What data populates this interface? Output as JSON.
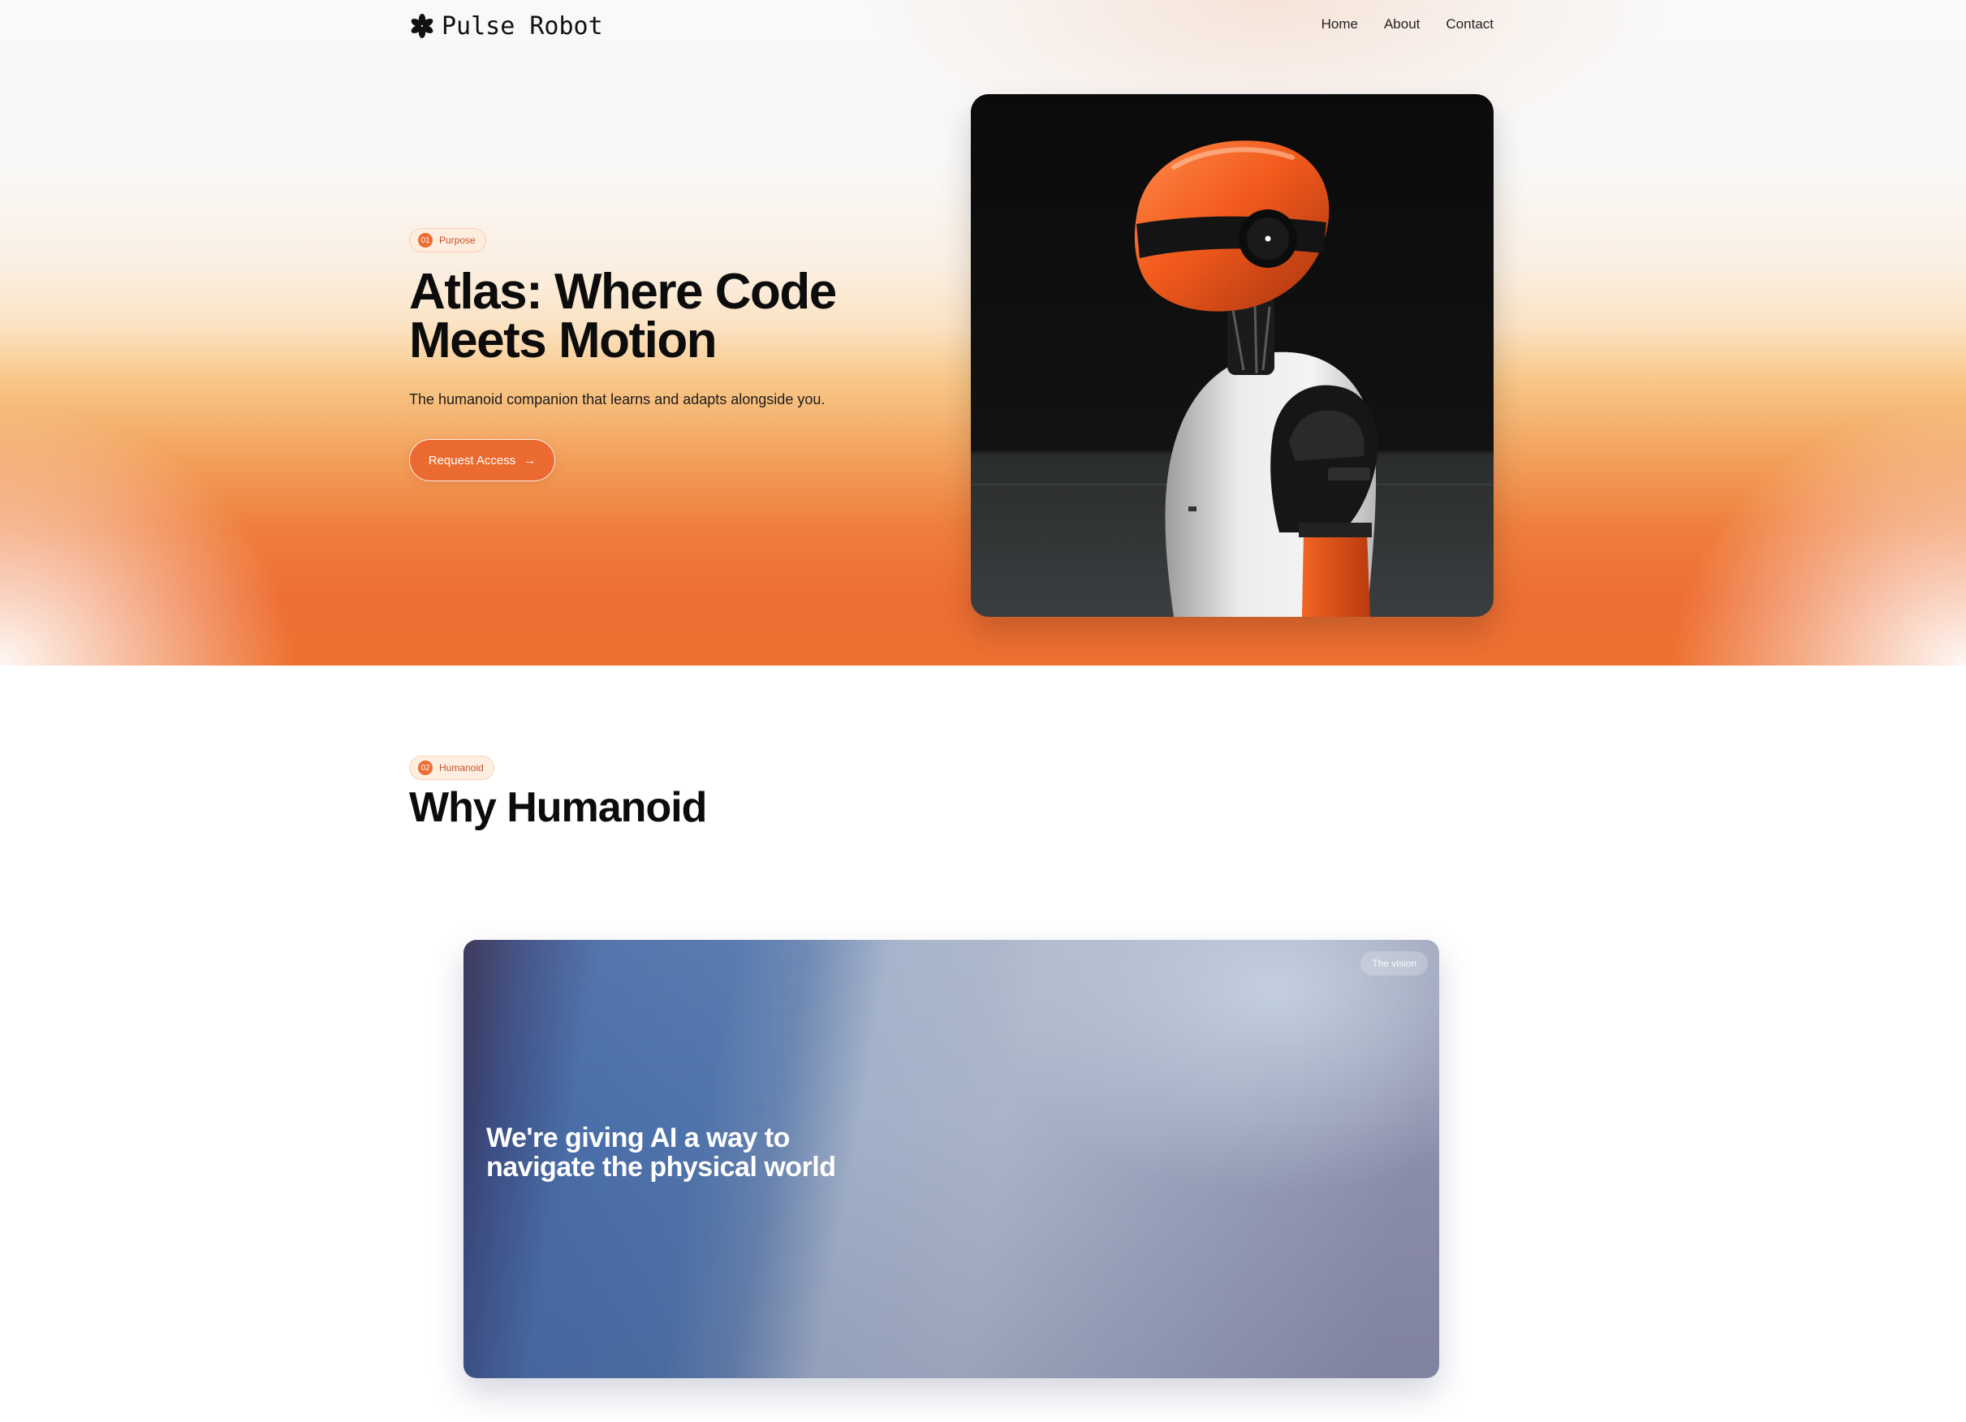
{
  "brand": {
    "name": "Pulse Robot",
    "logo_icon": "asterisk-icon"
  },
  "nav": {
    "links": [
      "Home",
      "About",
      "Contact"
    ]
  },
  "hero": {
    "badge_number": "01",
    "badge_label": "Purpose",
    "title_line1": "Atlas: Where Code",
    "title_line2": "Meets Motion",
    "subtitle": "The humanoid companion that learns and adapts alongside you.",
    "cta_label": "Request Access",
    "cta_icon": "arrow-right-icon"
  },
  "section": {
    "badge_number": "02",
    "badge_label": "Humanoid",
    "title": "Why Humanoid"
  },
  "vision_card": {
    "badge": "The vision",
    "text_line1": "We're giving AI a way to",
    "text_line2": "navigate the physical world"
  },
  "colors": {
    "accent": "#ee6b33",
    "hero_warm": "#ee7130",
    "card_blue": "#4a6ea8",
    "card_gray": "#a2b0c8"
  }
}
